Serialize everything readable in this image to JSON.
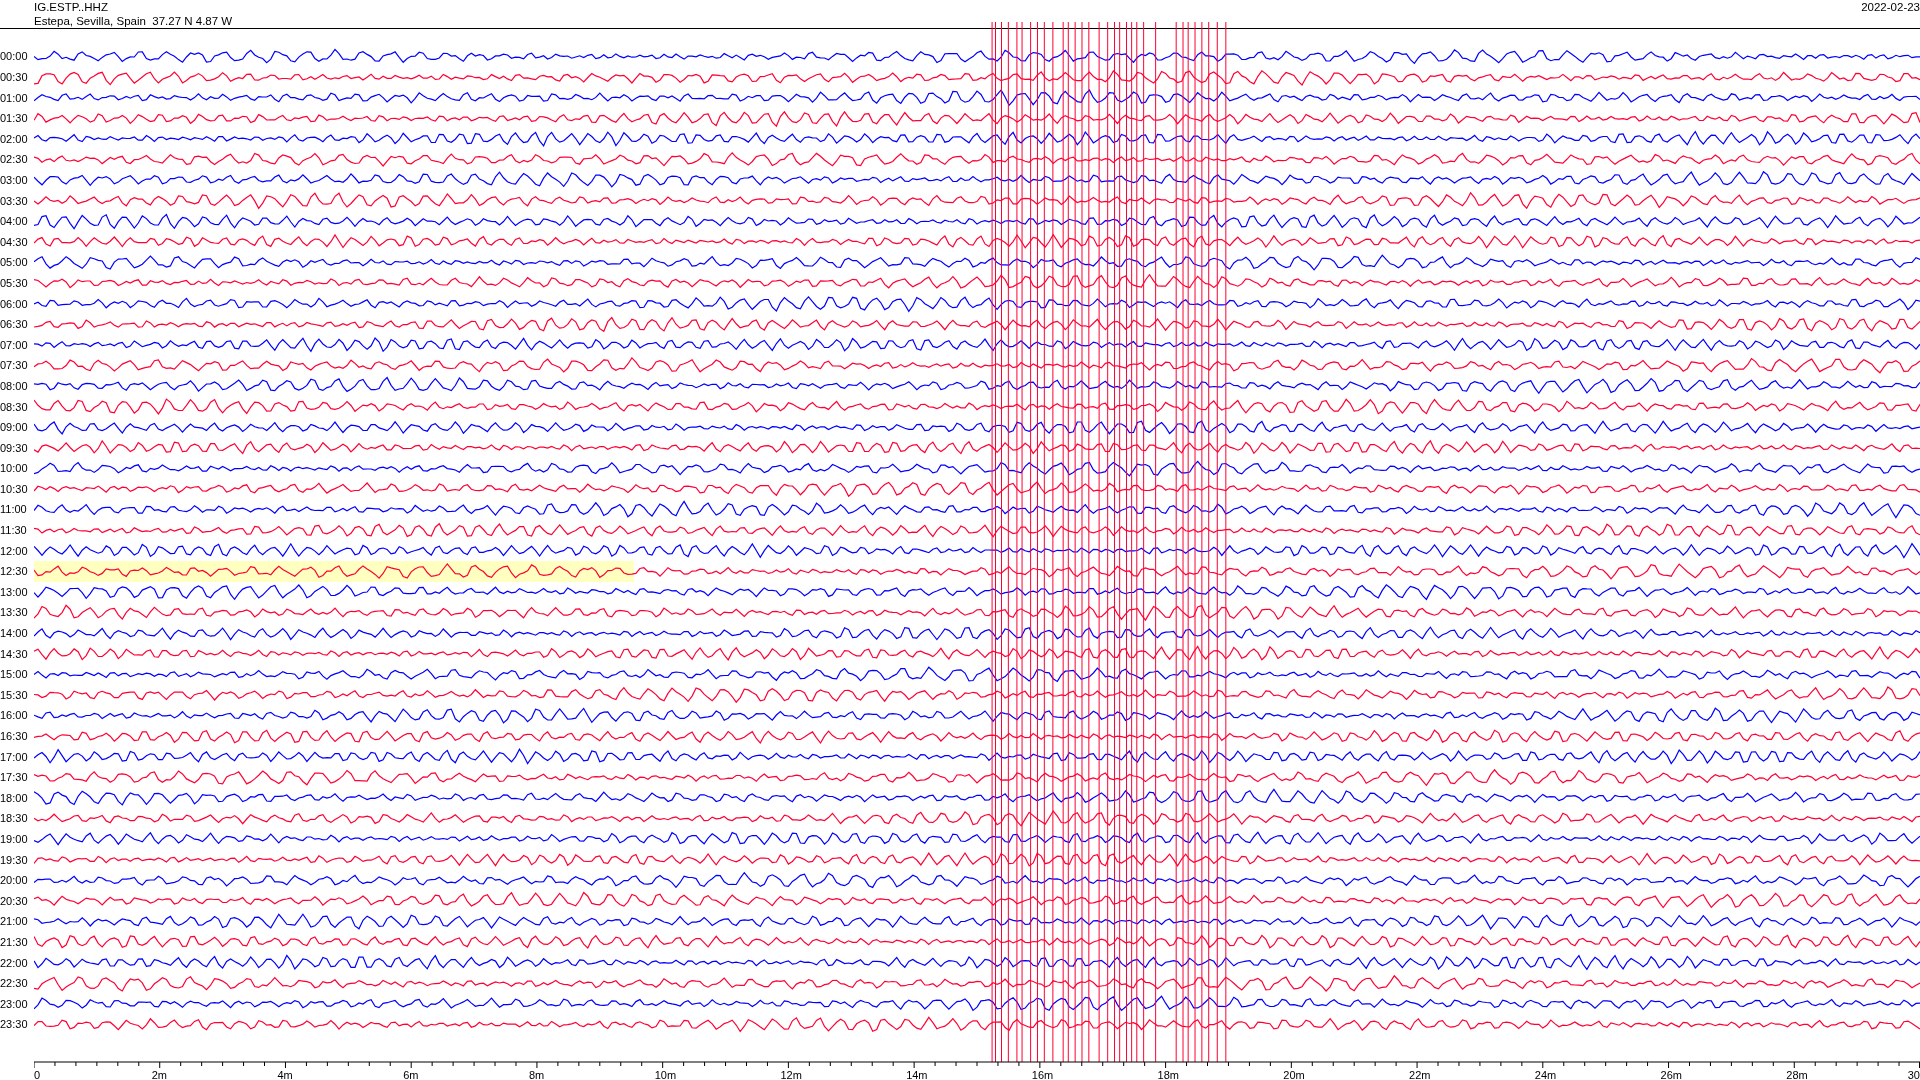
{
  "header": {
    "station": "IG.ESTP..HHZ",
    "location": "Estepa, Sevilla, Spain  37.27 N 4.87 W",
    "date": "2022-02-23"
  },
  "rows": [
    {
      "label": "00:00",
      "color": "#0000ff",
      "highlighted": false
    },
    {
      "label": "00:30",
      "color": "#ff0033",
      "highlighted": false
    },
    {
      "label": "01:00",
      "color": "#0000ff",
      "highlighted": false
    },
    {
      "label": "01:30",
      "color": "#ff0033",
      "highlighted": false
    },
    {
      "label": "02:00",
      "color": "#0000ff",
      "highlighted": false
    },
    {
      "label": "02:30",
      "color": "#ff0033",
      "highlighted": false
    },
    {
      "label": "03:00",
      "color": "#0000ff",
      "highlighted": false
    },
    {
      "label": "03:30",
      "color": "#ff0033",
      "highlighted": false
    },
    {
      "label": "04:00",
      "color": "#0000ff",
      "highlighted": false
    },
    {
      "label": "04:30",
      "color": "#ff0033",
      "highlighted": false
    },
    {
      "label": "05:00",
      "color": "#0000ff",
      "highlighted": false
    },
    {
      "label": "05:30",
      "color": "#ff0033",
      "highlighted": false
    },
    {
      "label": "06:00",
      "color": "#0000ff",
      "highlighted": false
    },
    {
      "label": "06:30",
      "color": "#ff0033",
      "highlighted": false
    },
    {
      "label": "07:00",
      "color": "#0000ff",
      "highlighted": false
    },
    {
      "label": "07:30",
      "color": "#ff0033",
      "highlighted": false
    },
    {
      "label": "08:00",
      "color": "#0000ff",
      "highlighted": false
    },
    {
      "label": "08:30",
      "color": "#ff0033",
      "highlighted": false
    },
    {
      "label": "09:00",
      "color": "#0000ff",
      "highlighted": false
    },
    {
      "label": "09:30",
      "color": "#ff0033",
      "highlighted": false
    },
    {
      "label": "10:00",
      "color": "#0000ff",
      "highlighted": false
    },
    {
      "label": "10:30",
      "color": "#ff0033",
      "highlighted": false
    },
    {
      "label": "11:00",
      "color": "#0000ff",
      "highlighted": false
    },
    {
      "label": "11:30",
      "color": "#ff0033",
      "highlighted": false
    },
    {
      "label": "12:00",
      "color": "#0000ff",
      "highlighted": false
    },
    {
      "label": "12:30",
      "color": "#ff0033",
      "highlighted": true
    },
    {
      "label": "13:00",
      "color": "#0000ff",
      "highlighted": false
    },
    {
      "label": "13:30",
      "color": "#ff0033",
      "highlighted": false
    },
    {
      "label": "14:00",
      "color": "#0000ff",
      "highlighted": false
    },
    {
      "label": "14:30",
      "color": "#ff0033",
      "highlighted": false
    },
    {
      "label": "15:00",
      "color": "#0000ff",
      "highlighted": false
    },
    {
      "label": "15:30",
      "color": "#ff0033",
      "highlighted": false
    },
    {
      "label": "16:00",
      "color": "#0000ff",
      "highlighted": false
    },
    {
      "label": "16:30",
      "color": "#ff0033",
      "highlighted": false
    },
    {
      "label": "17:00",
      "color": "#0000ff",
      "highlighted": false
    },
    {
      "label": "17:30",
      "color": "#ff0033",
      "highlighted": false
    },
    {
      "label": "18:00",
      "color": "#0000ff",
      "highlighted": false
    },
    {
      "label": "18:30",
      "color": "#ff0033",
      "highlighted": false
    },
    {
      "label": "19:00",
      "color": "#0000ff",
      "highlighted": false
    },
    {
      "label": "19:30",
      "color": "#ff0033",
      "highlighted": false
    },
    {
      "label": "20:00",
      "color": "#0000ff",
      "highlighted": false
    },
    {
      "label": "20:30",
      "color": "#ff0033",
      "highlighted": false
    },
    {
      "label": "21:00",
      "color": "#0000ff",
      "highlighted": false
    },
    {
      "label": "21:30",
      "color": "#ff0033",
      "highlighted": false
    },
    {
      "label": "22:00",
      "color": "#0000ff",
      "highlighted": false
    },
    {
      "label": "22:30",
      "color": "#ff0033",
      "highlighted": false
    },
    {
      "label": "23:00",
      "color": "#0000ff",
      "highlighted": false
    },
    {
      "label": "23:30",
      "color": "#ff0033",
      "highlighted": false
    }
  ],
  "axis": {
    "ticks": [
      "0",
      "2m",
      "4m",
      "6m",
      "8m",
      "10m",
      "12m",
      "14m",
      "16m",
      "18m",
      "20m",
      "22m",
      "24m",
      "26m",
      "28m",
      "30"
    ]
  }
}
